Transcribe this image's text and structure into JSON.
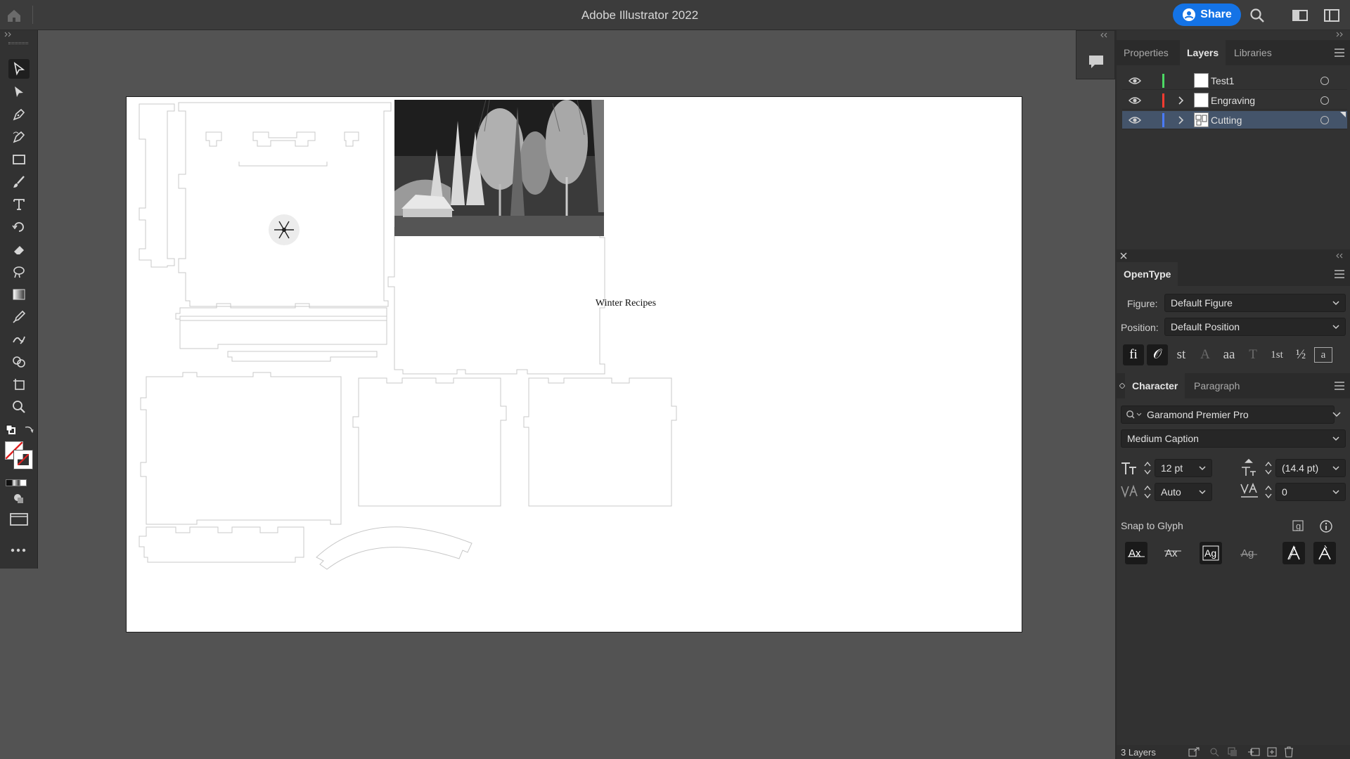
{
  "app": {
    "title": "Adobe Illustrator 2022",
    "share_label": "Share"
  },
  "artboard": {
    "text": "Winter Recipes"
  },
  "panels": {
    "tabs": [
      "Properties",
      "Layers",
      "Libraries"
    ],
    "active_tab": "Layers",
    "layers": [
      {
        "name": "Test1",
        "color": "#4cd964",
        "selected": false,
        "expandable": false
      },
      {
        "name": "Engraving",
        "color": "#ff3b30",
        "selected": false,
        "expandable": true
      },
      {
        "name": "Cutting",
        "color": "#4a7bff",
        "selected": true,
        "expandable": true
      }
    ],
    "layer_count": "3 Layers"
  },
  "opentype": {
    "title": "OpenType",
    "figure_label": "Figure:",
    "figure_value": "Default Figure",
    "position_label": "Position:",
    "position_value": "Default Position",
    "buttons": [
      "fi",
      "𝒪",
      "st",
      "A",
      "aa",
      "T",
      "1st",
      "½",
      "a"
    ]
  },
  "character": {
    "tabs": [
      "Character",
      "Paragraph"
    ],
    "font_family": "Garamond Premier Pro",
    "font_style": "Medium Caption",
    "font_size": "12 pt",
    "leading": "(14.4 pt)",
    "kerning": "Auto",
    "tracking": "0",
    "snap_label": "Snap to Glyph"
  }
}
